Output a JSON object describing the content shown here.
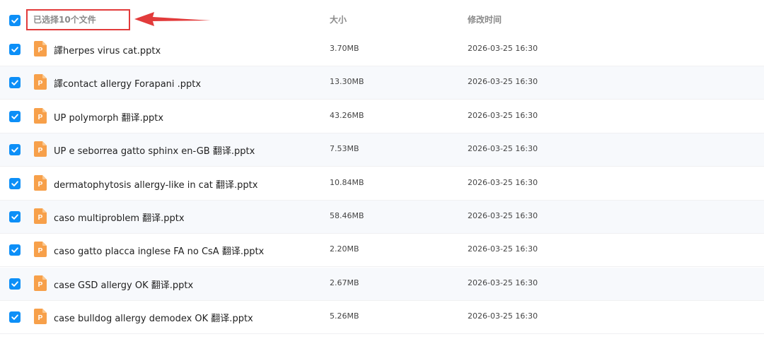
{
  "header": {
    "selected_label": "已选择10个文件",
    "size_label": "大小",
    "time_label": "修改时间"
  },
  "files": [
    {
      "name": "譯herpes virus cat.pptx",
      "size": "3.70MB",
      "modified": "2026-03-25 16:30"
    },
    {
      "name": "譯contact allergy Forapani .pptx",
      "size": "13.30MB",
      "modified": "2026-03-25 16:30"
    },
    {
      "name": "UP polymorph 翻译.pptx",
      "size": "43.26MB",
      "modified": "2026-03-25 16:30"
    },
    {
      "name": "UP e seborrea gatto sphinx en-GB 翻译.pptx",
      "size": "7.53MB",
      "modified": "2026-03-25 16:30"
    },
    {
      "name": "dermatophytosis allergy-like in cat 翻译.pptx",
      "size": "10.84MB",
      "modified": "2026-03-25 16:30"
    },
    {
      "name": "caso multiproblem 翻译.pptx",
      "size": "58.46MB",
      "modified": "2026-03-25 16:30"
    },
    {
      "name": "caso gatto placca inglese FA no CsA 翻译.pptx",
      "size": "2.20MB",
      "modified": "2026-03-25 16:30"
    },
    {
      "name": "case GSD allergy OK 翻译.pptx",
      "size": "2.67MB",
      "modified": "2026-03-25 16:30"
    },
    {
      "name": "case bulldog allergy demodex OK 翻译.pptx",
      "size": "5.26MB",
      "modified": "2026-03-25 16:30"
    }
  ],
  "file_icon": {
    "name": "pptx-file-icon",
    "letter": "P",
    "color": "#f7a04a"
  },
  "colors": {
    "checkbox": "#0d8ff7",
    "annotation": "#e23b3b",
    "row_alt": "#f7f9fc"
  }
}
